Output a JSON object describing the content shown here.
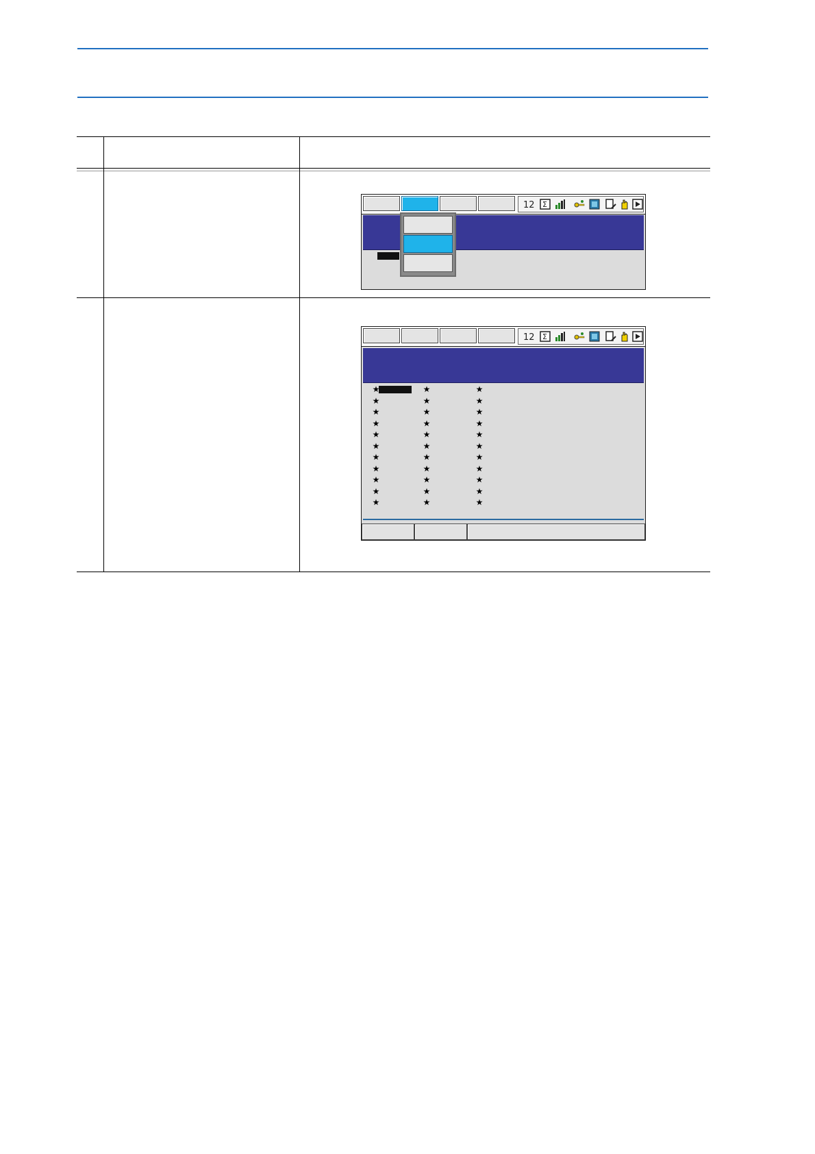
{
  "document": {
    "rule_color": "#1f6fc0",
    "table_columns": [
      "",
      "",
      ""
    ],
    "rows": [
      {
        "step": "",
        "operation": "",
        "explanation": ""
      },
      {
        "step": "",
        "operation": "",
        "explanation": ""
      }
    ]
  },
  "screen1": {
    "menu_buttons": [
      "",
      "",
      "",
      ""
    ],
    "active_menu_index": 1,
    "dropdown_items": [
      "",
      "",
      ""
    ],
    "selected_dropdown_index": 1,
    "status_icons": [
      "job-counter-icon",
      "sigma-icon",
      "signal-icon",
      "key-icon",
      "storage-icon",
      "edit-icon",
      "hand-icon",
      "play-icon"
    ]
  },
  "screen2": {
    "menu_buttons": [
      "",
      "",
      "",
      ""
    ],
    "status_icons": [
      "job-counter-icon",
      "sigma-icon",
      "signal-icon",
      "key-icon",
      "storage-icon",
      "edit-icon",
      "hand-icon",
      "play-icon"
    ],
    "star_glyph": "★",
    "star_rows": 11,
    "star_columns": 3,
    "function_keys": [
      "",
      "",
      ""
    ]
  },
  "colors": {
    "panel_blue": "#383896",
    "selected_cyan": "#1fb3ea",
    "screen_gray": "#dcdcdc"
  }
}
